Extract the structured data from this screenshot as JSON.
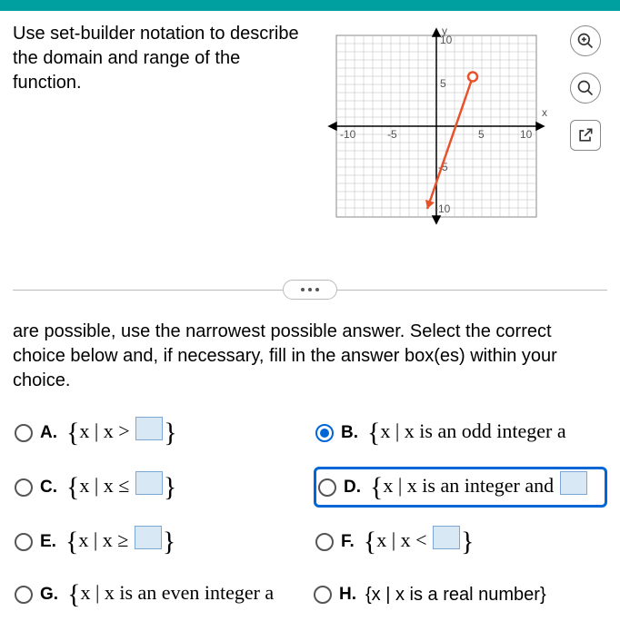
{
  "prompt": "Use set-builder notation to describe the domain and range of the function.",
  "instructions": "are possible, use the narrowest possible answer. Select the correct choice below and, if necessary, fill in the answer box(es) within your choice.",
  "axis": {
    "x": "x",
    "y": "y",
    "ticks": [
      "-10",
      "-5",
      "5",
      "10",
      "5",
      "-5",
      "-10"
    ]
  },
  "choices": {
    "A": {
      "letter": "A.",
      "pref": "x | x >"
    },
    "B": {
      "letter": "B.",
      "text": "x | x is an odd integer a"
    },
    "C": {
      "letter": "C.",
      "pref": "x | x ≤"
    },
    "D": {
      "letter": "D.",
      "text": "x | x is an integer and"
    },
    "E": {
      "letter": "E.",
      "pref": "x | x ≥"
    },
    "F": {
      "letter": "F.",
      "pref": "x | x <"
    },
    "G": {
      "letter": "G.",
      "text": "x | x is an even integer a"
    },
    "H": {
      "letter": "H.",
      "text": "{x | x is a real number}"
    }
  },
  "chart_data": {
    "type": "line",
    "title": "",
    "xlabel": "x",
    "ylabel": "y",
    "xlim": [
      -11,
      11
    ],
    "ylim": [
      -11,
      11
    ],
    "series": [
      {
        "name": "segment",
        "points": [
          [
            -1,
            -10
          ],
          [
            4,
            6
          ]
        ],
        "endpoint_open_at_end": true,
        "arrow_at_start": true
      }
    ]
  }
}
